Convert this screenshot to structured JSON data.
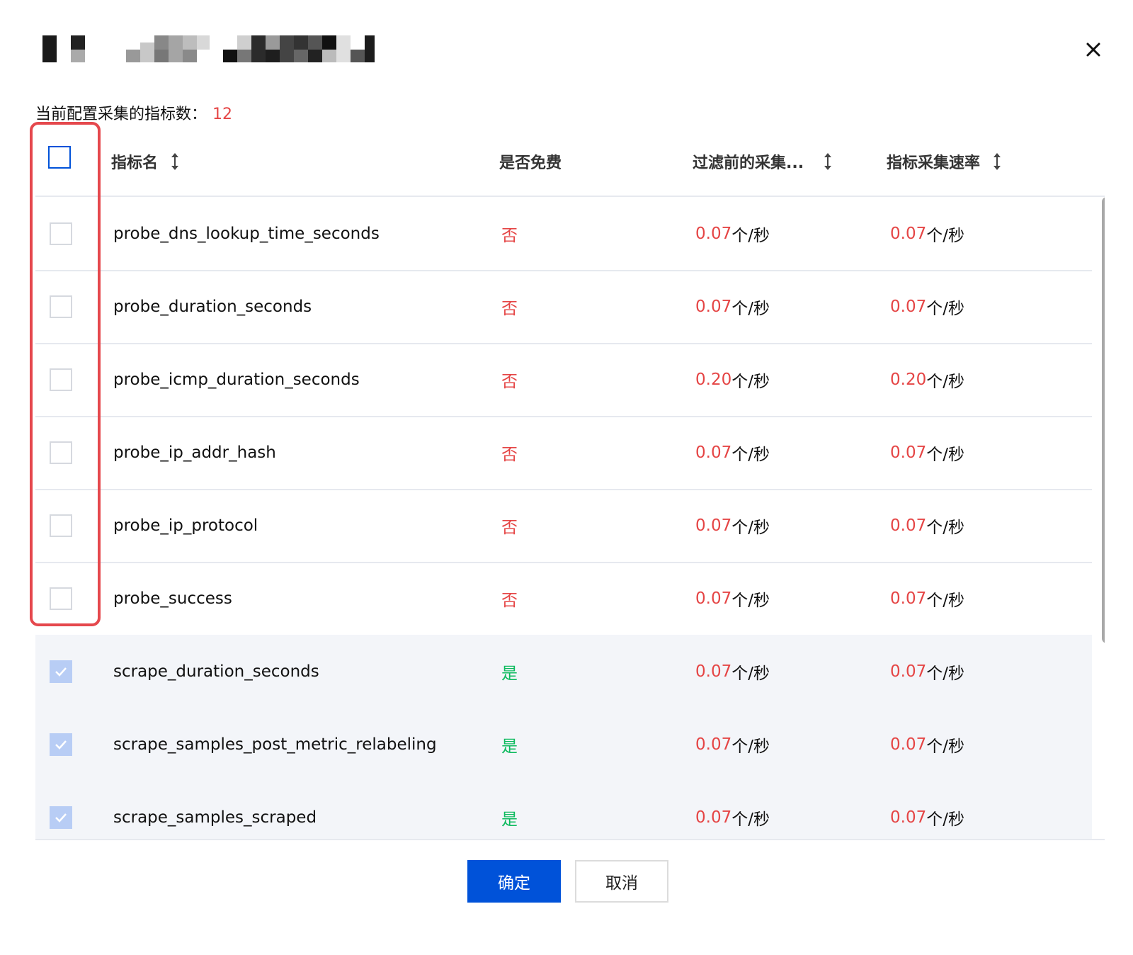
{
  "dialog": {
    "close_icon": "close-icon",
    "count_label": "当前配置采集的指标数：",
    "count_value": "12"
  },
  "table": {
    "columns": [
      {
        "label": "指标名",
        "sortable": true
      },
      {
        "label": "是否免费",
        "sortable": false
      },
      {
        "label": "过滤前的采集...",
        "sortable": true
      },
      {
        "label": "指标采集速率",
        "sortable": true
      }
    ],
    "rows": [
      {
        "name": "probe_dns_lookup_time_seconds",
        "free": "否",
        "before_value": "0.07",
        "before_unit": "个/秒",
        "rate_value": "0.07",
        "rate_unit": "个/秒",
        "checked": false
      },
      {
        "name": "probe_duration_seconds",
        "free": "否",
        "before_value": "0.07",
        "before_unit": "个/秒",
        "rate_value": "0.07",
        "rate_unit": "个/秒",
        "checked": false
      },
      {
        "name": "probe_icmp_duration_seconds",
        "free": "否",
        "before_value": "0.20",
        "before_unit": "个/秒",
        "rate_value": "0.20",
        "rate_unit": "个/秒",
        "checked": false
      },
      {
        "name": "probe_ip_addr_hash",
        "free": "否",
        "before_value": "0.07",
        "before_unit": "个/秒",
        "rate_value": "0.07",
        "rate_unit": "个/秒",
        "checked": false
      },
      {
        "name": "probe_ip_protocol",
        "free": "否",
        "before_value": "0.07",
        "before_unit": "个/秒",
        "rate_value": "0.07",
        "rate_unit": "个/秒",
        "checked": false
      },
      {
        "name": "probe_success",
        "free": "否",
        "before_value": "0.07",
        "before_unit": "个/秒",
        "rate_value": "0.07",
        "rate_unit": "个/秒",
        "checked": false
      },
      {
        "name": "scrape_duration_seconds",
        "free": "是",
        "before_value": "0.07",
        "before_unit": "个/秒",
        "rate_value": "0.07",
        "rate_unit": "个/秒",
        "checked": true
      },
      {
        "name": "scrape_samples_post_metric_relabeling",
        "free": "是",
        "before_value": "0.07",
        "before_unit": "个/秒",
        "rate_value": "0.07",
        "rate_unit": "个/秒",
        "checked": true
      },
      {
        "name": "scrape_samples_scraped",
        "free": "是",
        "before_value": "0.07",
        "before_unit": "个/秒",
        "rate_value": "0.07",
        "rate_unit": "个/秒",
        "checked": true
      }
    ]
  },
  "footer": {
    "confirm_label": "确定",
    "cancel_label": "取消"
  },
  "colors": {
    "primary": "#0052d9",
    "danger": "#e54545",
    "success": "#0cba5e",
    "highlight": "#e5484d"
  }
}
